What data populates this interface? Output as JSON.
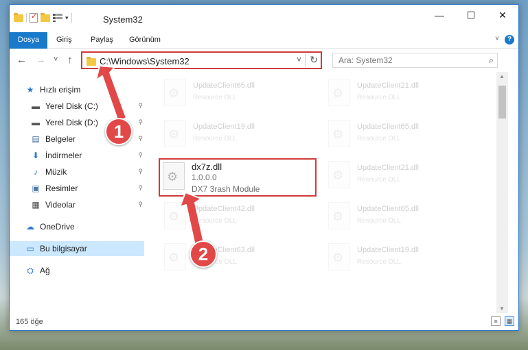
{
  "window": {
    "title": "System32",
    "controls": {
      "minimize": "—",
      "maximize": "☐",
      "close": "✕"
    }
  },
  "quick_access_toolbar": {
    "dropdown": "▾"
  },
  "ribbon": {
    "tabs": [
      "Dosya",
      "Giriş",
      "Paylaş",
      "Görünüm"
    ],
    "help": "?",
    "collapse": "˅"
  },
  "navigation": {
    "back": "←",
    "forward": "→",
    "recent": "˅",
    "up": "↑",
    "address": "C:\\Windows\\System32",
    "address_dropdown": "˅",
    "refresh": "↻",
    "search_placeholder": "Ara: System32",
    "search_icon": "⌕"
  },
  "nav_pane": {
    "items": [
      {
        "label": "Hızlı erişim",
        "icon": "star-icon",
        "glyph": "★",
        "color": "#2b79d0",
        "pinned": false
      },
      {
        "label": "Yerel Disk (C:)",
        "icon": "drive-icon",
        "glyph": "▬",
        "color": "#555555",
        "pinned": true
      },
      {
        "label": "Yerel Disk (D:)",
        "icon": "drive-icon",
        "glyph": "▬",
        "color": "#555555",
        "pinned": true
      },
      {
        "label": "Belgeler",
        "icon": "documents-icon",
        "glyph": "▤",
        "color": "#4a6fa0",
        "pinned": true
      },
      {
        "label": "İndirmeler",
        "icon": "download-icon",
        "glyph": "⬇",
        "color": "#2b79d0",
        "pinned": true
      },
      {
        "label": "Müzik",
        "icon": "music-icon",
        "glyph": "♪",
        "color": "#2b79d0",
        "pinned": true
      },
      {
        "label": "Resimler",
        "icon": "pictures-icon",
        "glyph": "▣",
        "color": "#4a7aa8",
        "pinned": true
      },
      {
        "label": "Videolar",
        "icon": "video-icon",
        "glyph": "▦",
        "color": "#444444",
        "pinned": true
      },
      {
        "label": "OneDrive",
        "icon": "cloud-icon",
        "glyph": "☁",
        "color": "#2b79d0",
        "pinned": false
      },
      {
        "label": "Bu bilgisayar",
        "icon": "computer-icon",
        "glyph": "▭",
        "color": "#2b79d0",
        "pinned": false
      },
      {
        "label": "Ağ",
        "icon": "network-icon",
        "glyph": "⛭",
        "color": "#2b79d0",
        "pinned": false
      }
    ],
    "pin_glyph": "📌"
  },
  "files": [
    {
      "name": "UpdateClient65.dll",
      "desc": "Resource DLL"
    },
    {
      "name": "UpdateClient21.dll",
      "desc": "Resource DLL"
    },
    {
      "name": "UpdateClient19.dll",
      "desc": "Resource DLL"
    },
    {
      "name": "UpdateClient65.dll",
      "desc": "Resource DLL"
    },
    {
      "name": "dx7z.dll",
      "version": "1.0.0.0",
      "desc": "DX7 3rash Module"
    },
    {
      "name": "UpdateClient21.dll",
      "desc": "Resource DLL"
    },
    {
      "name": "UpdateClient42.dll",
      "desc": "Resource DLL"
    },
    {
      "name": "UpdateClient65.dll",
      "desc": "Resource DLL"
    },
    {
      "name": "UpdateClient63.dll",
      "desc": "Resource DLL"
    },
    {
      "name": "UpdateClient19.dll",
      "desc": "Resource DLL"
    }
  ],
  "status": {
    "item_count": "165 öğe"
  },
  "callouts": [
    "1",
    "2"
  ],
  "colors": {
    "accent": "#1979ca",
    "highlight": "#d03a3a",
    "callout": "#e24848"
  }
}
